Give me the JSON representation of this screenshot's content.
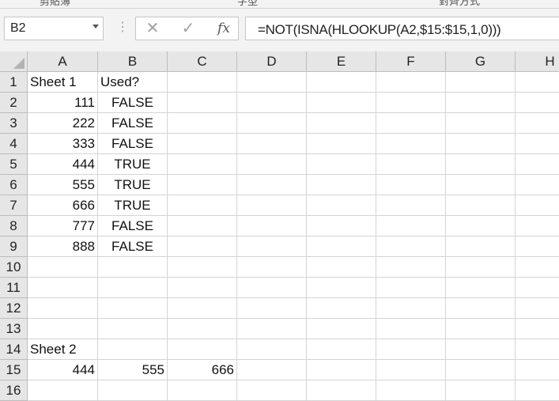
{
  "ribbon": {
    "fragments": [
      "剪貼簿",
      "字型",
      "對齊方式"
    ]
  },
  "formula_bar": {
    "name_box": "B2",
    "cancel_icon": "✕",
    "enter_icon": "✓",
    "function_icon": "fx",
    "formula": "=NOT(ISNA(HLOOKUP(A2,$15:$15,1,0)))"
  },
  "columns": [
    "A",
    "B",
    "C",
    "D",
    "E",
    "F",
    "G",
    "H"
  ],
  "rows": [
    "1",
    "2",
    "3",
    "4",
    "5",
    "6",
    "7",
    "8",
    "9",
    "10",
    "11",
    "12",
    "13",
    "14",
    "15",
    "16"
  ],
  "cells": {
    "A1": "Sheet 1",
    "B1": "Used?",
    "A2": "111",
    "B2": "FALSE",
    "A3": "222",
    "B3": "FALSE",
    "A4": "333",
    "B4": "FALSE",
    "A5": "444",
    "B5": "TRUE",
    "A6": "555",
    "B6": "TRUE",
    "A7": "666",
    "B7": "TRUE",
    "A8": "777",
    "B8": "FALSE",
    "A9": "888",
    "B9": "FALSE",
    "A14": "Sheet 2",
    "A15": "444",
    "B15": "555",
    "C15": "666"
  },
  "selected_cell": "B2"
}
